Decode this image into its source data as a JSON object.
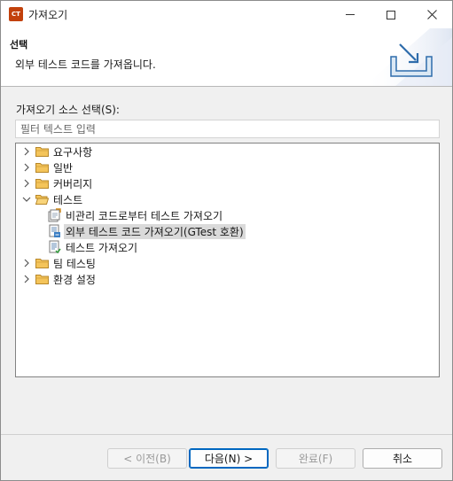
{
  "window": {
    "title": "가져오기",
    "app_icon_text": "CT"
  },
  "header": {
    "title": "선택",
    "description": "외부 테스트 코드를 가져옵니다."
  },
  "source_select_label": "가져오기 소스 선택(S):",
  "filter": {
    "placeholder": "필터 텍스트 입력",
    "value": ""
  },
  "tree": {
    "items": [
      {
        "label": "요구사항",
        "expanded": false,
        "depth": 0,
        "type": "folder"
      },
      {
        "label": "일반",
        "expanded": false,
        "depth": 0,
        "type": "folder"
      },
      {
        "label": "커버리지",
        "expanded": false,
        "depth": 0,
        "type": "folder"
      },
      {
        "label": "테스트",
        "expanded": true,
        "depth": 0,
        "type": "folder"
      },
      {
        "label": "비관리 코드로부터 테스트 가져오기",
        "depth": 1,
        "type": "wizard-unmanaged"
      },
      {
        "label": "외부 테스트 코드 가져오기(GTest 호환)",
        "depth": 1,
        "type": "wizard-external",
        "selected": true
      },
      {
        "label": "테스트 가져오기",
        "depth": 1,
        "type": "wizard-test"
      },
      {
        "label": "팀 테스팅",
        "expanded": false,
        "depth": 0,
        "type": "folder"
      },
      {
        "label": "환경 설정",
        "expanded": false,
        "depth": 0,
        "type": "folder"
      }
    ]
  },
  "buttons": {
    "back": "< 이전(B)",
    "next": "다음(N) >",
    "finish": "완료(F)",
    "cancel": "취소"
  },
  "colors": {
    "accent": "#0067c0",
    "folder": "#e8b04a",
    "selection": "#dadada"
  }
}
